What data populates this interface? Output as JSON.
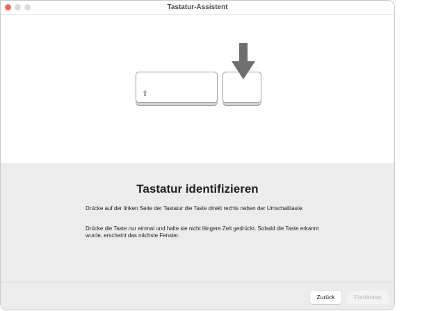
{
  "window": {
    "title": "Tastatur-Assistent"
  },
  "main": {
    "heading": "Tastatur identifizieren",
    "paragraph1": "Drücke auf der linken Seite der Tastatur die Taste direkt rechts neben der Umschalttaste.",
    "paragraph2": "Drücke die Taste nur einmal und halte sie nicht längere Zeit gedrückt. Sobald die Taste erkannt wurde, erscheint das nächste Fenster.",
    "shift_symbol": "⇧"
  },
  "buttons": {
    "back": "Zurück",
    "continue": "Fortfahren"
  },
  "colors": {
    "close": "#ec6a5e",
    "inactive": "#dcdcdc"
  }
}
